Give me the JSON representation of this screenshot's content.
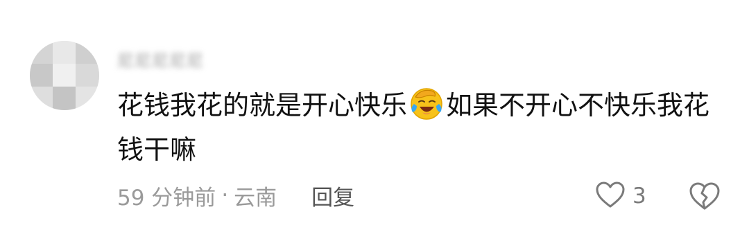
{
  "comment": {
    "username": "尼尼尼尼尼",
    "text_before_emoji": "花钱我花的就是开心快乐",
    "emoji": "face-with-tears-of-joy-emoji",
    "text_after_emoji": "如果不开心不快乐我花钱干嘛",
    "time": "59 分钟前",
    "separator": "·",
    "location": "云南",
    "reply_label": "回复",
    "like_count": "3"
  },
  "colors": {
    "text_primary": "#111111",
    "text_secondary": "#9a9a9a",
    "icon_gray": "#7a7a7a",
    "emoji_yellow": "#f7c21a",
    "emoji_blue": "#39a7f0"
  },
  "icons": [
    "heart-outline-icon",
    "broken-heart-icon"
  ]
}
